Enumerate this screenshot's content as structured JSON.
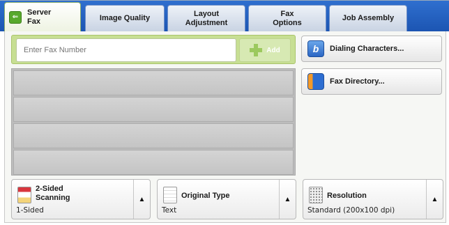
{
  "tabs": [
    {
      "label": "Server\nFax",
      "active": true
    },
    {
      "label": "Image Quality",
      "active": false
    },
    {
      "label": "Layout\nAdjustment",
      "active": false
    },
    {
      "label": "Fax\nOptions",
      "active": false
    },
    {
      "label": "Job Assembly",
      "active": false
    }
  ],
  "fax_entry": {
    "placeholder": "Enter Fax Number",
    "add_label": "Add"
  },
  "side_buttons": {
    "dialing": "Dialing Characters...",
    "directory": "Fax Directory..."
  },
  "options": {
    "two_sided": {
      "title": "2-Sided\nScanning",
      "value": "1-Sided"
    },
    "original_type": {
      "title": "Original Type",
      "value": "Text"
    },
    "resolution": {
      "title": "Resolution",
      "value": "Standard (200x100 dpi)"
    }
  },
  "colors": {
    "tab_bar": "#1c55b2",
    "active_tab_icon": "#58a92d",
    "fax_row": "#c7df93"
  },
  "icons": {
    "active_tab": "server-fax-icon",
    "add": "plus-icon",
    "dialing": "dialing-characters-icon",
    "directory": "fax-directory-icon",
    "two_sided": "two-sided-scanning-icon",
    "original_type": "document-icon",
    "resolution": "resolution-icon",
    "arrow": "triangle-up-icon"
  }
}
